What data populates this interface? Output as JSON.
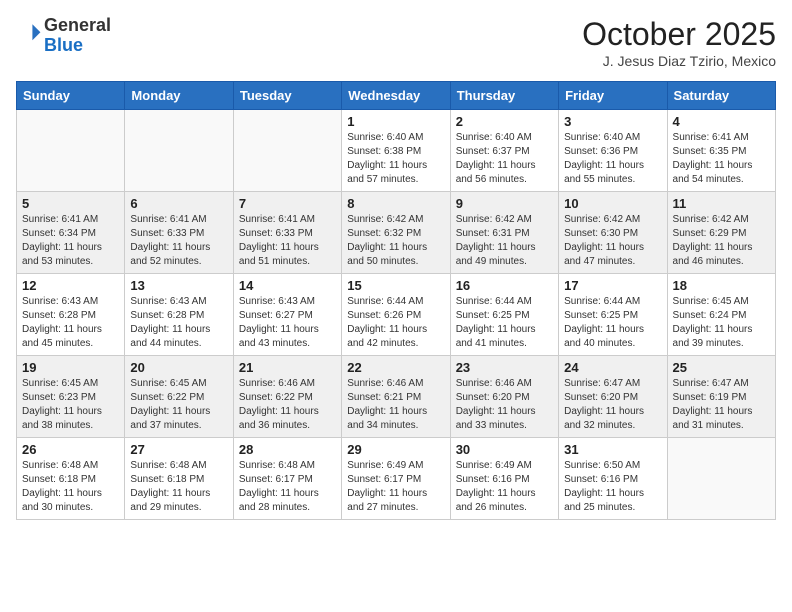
{
  "header": {
    "logo_general": "General",
    "logo_blue": "Blue",
    "month": "October 2025",
    "location": "J. Jesus Diaz Tzirio, Mexico"
  },
  "weekdays": [
    "Sunday",
    "Monday",
    "Tuesday",
    "Wednesday",
    "Thursday",
    "Friday",
    "Saturday"
  ],
  "weeks": [
    [
      {
        "day": "",
        "detail": ""
      },
      {
        "day": "",
        "detail": ""
      },
      {
        "day": "",
        "detail": ""
      },
      {
        "day": "1",
        "detail": "Sunrise: 6:40 AM\nSunset: 6:38 PM\nDaylight: 11 hours and 57 minutes."
      },
      {
        "day": "2",
        "detail": "Sunrise: 6:40 AM\nSunset: 6:37 PM\nDaylight: 11 hours and 56 minutes."
      },
      {
        "day": "3",
        "detail": "Sunrise: 6:40 AM\nSunset: 6:36 PM\nDaylight: 11 hours and 55 minutes."
      },
      {
        "day": "4",
        "detail": "Sunrise: 6:41 AM\nSunset: 6:35 PM\nDaylight: 11 hours and 54 minutes."
      }
    ],
    [
      {
        "day": "5",
        "detail": "Sunrise: 6:41 AM\nSunset: 6:34 PM\nDaylight: 11 hours and 53 minutes."
      },
      {
        "day": "6",
        "detail": "Sunrise: 6:41 AM\nSunset: 6:33 PM\nDaylight: 11 hours and 52 minutes."
      },
      {
        "day": "7",
        "detail": "Sunrise: 6:41 AM\nSunset: 6:33 PM\nDaylight: 11 hours and 51 minutes."
      },
      {
        "day": "8",
        "detail": "Sunrise: 6:42 AM\nSunset: 6:32 PM\nDaylight: 11 hours and 50 minutes."
      },
      {
        "day": "9",
        "detail": "Sunrise: 6:42 AM\nSunset: 6:31 PM\nDaylight: 11 hours and 49 minutes."
      },
      {
        "day": "10",
        "detail": "Sunrise: 6:42 AM\nSunset: 6:30 PM\nDaylight: 11 hours and 47 minutes."
      },
      {
        "day": "11",
        "detail": "Sunrise: 6:42 AM\nSunset: 6:29 PM\nDaylight: 11 hours and 46 minutes."
      }
    ],
    [
      {
        "day": "12",
        "detail": "Sunrise: 6:43 AM\nSunset: 6:28 PM\nDaylight: 11 hours and 45 minutes."
      },
      {
        "day": "13",
        "detail": "Sunrise: 6:43 AM\nSunset: 6:28 PM\nDaylight: 11 hours and 44 minutes."
      },
      {
        "day": "14",
        "detail": "Sunrise: 6:43 AM\nSunset: 6:27 PM\nDaylight: 11 hours and 43 minutes."
      },
      {
        "day": "15",
        "detail": "Sunrise: 6:44 AM\nSunset: 6:26 PM\nDaylight: 11 hours and 42 minutes."
      },
      {
        "day": "16",
        "detail": "Sunrise: 6:44 AM\nSunset: 6:25 PM\nDaylight: 11 hours and 41 minutes."
      },
      {
        "day": "17",
        "detail": "Sunrise: 6:44 AM\nSunset: 6:25 PM\nDaylight: 11 hours and 40 minutes."
      },
      {
        "day": "18",
        "detail": "Sunrise: 6:45 AM\nSunset: 6:24 PM\nDaylight: 11 hours and 39 minutes."
      }
    ],
    [
      {
        "day": "19",
        "detail": "Sunrise: 6:45 AM\nSunset: 6:23 PM\nDaylight: 11 hours and 38 minutes."
      },
      {
        "day": "20",
        "detail": "Sunrise: 6:45 AM\nSunset: 6:22 PM\nDaylight: 11 hours and 37 minutes."
      },
      {
        "day": "21",
        "detail": "Sunrise: 6:46 AM\nSunset: 6:22 PM\nDaylight: 11 hours and 36 minutes."
      },
      {
        "day": "22",
        "detail": "Sunrise: 6:46 AM\nSunset: 6:21 PM\nDaylight: 11 hours and 34 minutes."
      },
      {
        "day": "23",
        "detail": "Sunrise: 6:46 AM\nSunset: 6:20 PM\nDaylight: 11 hours and 33 minutes."
      },
      {
        "day": "24",
        "detail": "Sunrise: 6:47 AM\nSunset: 6:20 PM\nDaylight: 11 hours and 32 minutes."
      },
      {
        "day": "25",
        "detail": "Sunrise: 6:47 AM\nSunset: 6:19 PM\nDaylight: 11 hours and 31 minutes."
      }
    ],
    [
      {
        "day": "26",
        "detail": "Sunrise: 6:48 AM\nSunset: 6:18 PM\nDaylight: 11 hours and 30 minutes."
      },
      {
        "day": "27",
        "detail": "Sunrise: 6:48 AM\nSunset: 6:18 PM\nDaylight: 11 hours and 29 minutes."
      },
      {
        "day": "28",
        "detail": "Sunrise: 6:48 AM\nSunset: 6:17 PM\nDaylight: 11 hours and 28 minutes."
      },
      {
        "day": "29",
        "detail": "Sunrise: 6:49 AM\nSunset: 6:17 PM\nDaylight: 11 hours and 27 minutes."
      },
      {
        "day": "30",
        "detail": "Sunrise: 6:49 AM\nSunset: 6:16 PM\nDaylight: 11 hours and 26 minutes."
      },
      {
        "day": "31",
        "detail": "Sunrise: 6:50 AM\nSunset: 6:16 PM\nDaylight: 11 hours and 25 minutes."
      },
      {
        "day": "",
        "detail": ""
      }
    ]
  ]
}
